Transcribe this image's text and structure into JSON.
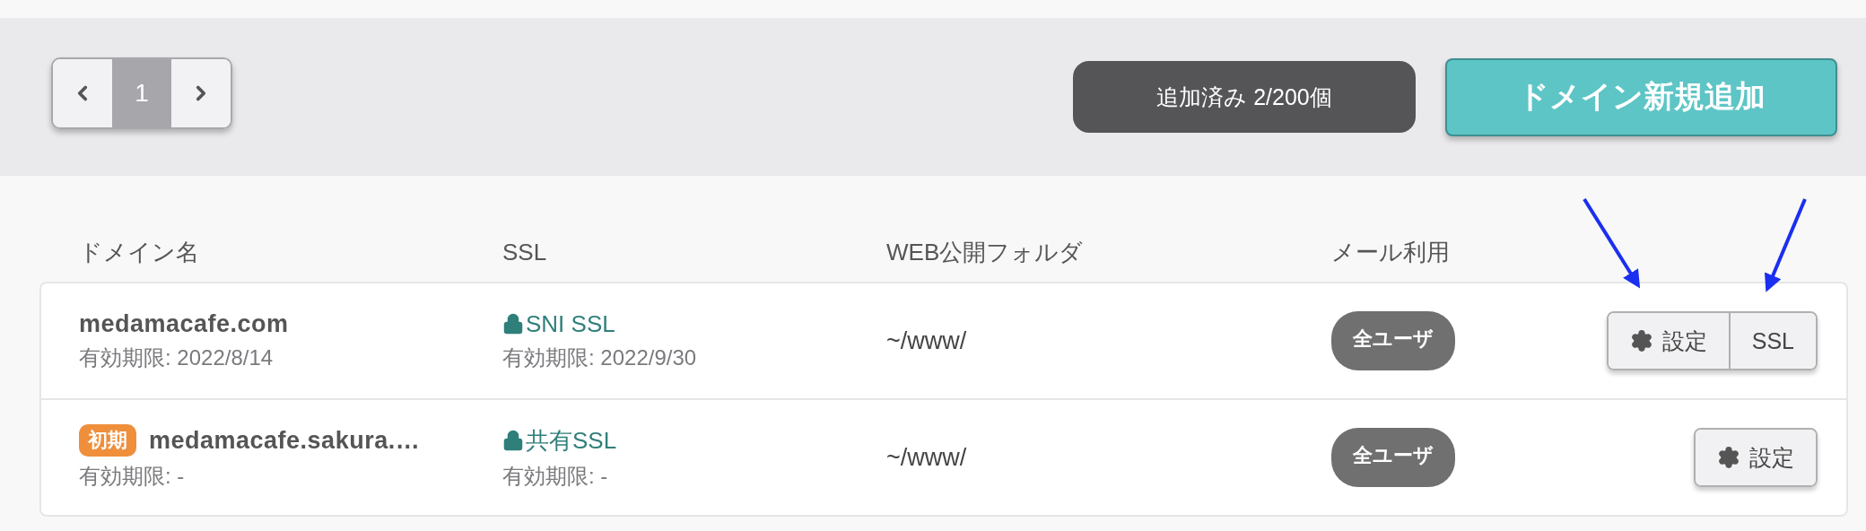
{
  "pager": {
    "pages": [
      {
        "label": "1",
        "selected": true
      }
    ]
  },
  "count_label": "追加済み 2/200個",
  "add_button": "ドメイン新規追加",
  "table": {
    "columns": [
      "ドメイン名",
      "SSL",
      "WEB公開フォルダ",
      "メール利用"
    ],
    "rows": [
      {
        "domain": "medamacafe.com",
        "domain_expiry": "有効期限: 2022/8/14",
        "ssl": "SNI SSL",
        "ssl_expiry": "有効期限: 2022/9/30",
        "folder": "~/www/",
        "mail": "全ユーザ",
        "actions": [
          {
            "kind": "settings",
            "label": "設定"
          },
          {
            "kind": "ssl",
            "label": "SSL"
          }
        ]
      },
      {
        "badge": "初期",
        "domain": "medamacafe.sakura.…",
        "domain_expiry": "有効期限: -",
        "ssl": "共有SSL",
        "ssl_expiry": "有効期限: -",
        "folder": "~/www/",
        "mail": "全ユーザ",
        "actions": [
          {
            "kind": "settings",
            "label": "設定"
          }
        ]
      }
    ]
  },
  "annotations": [
    {
      "kind": "arrow"
    },
    {
      "kind": "arrow"
    }
  ]
}
